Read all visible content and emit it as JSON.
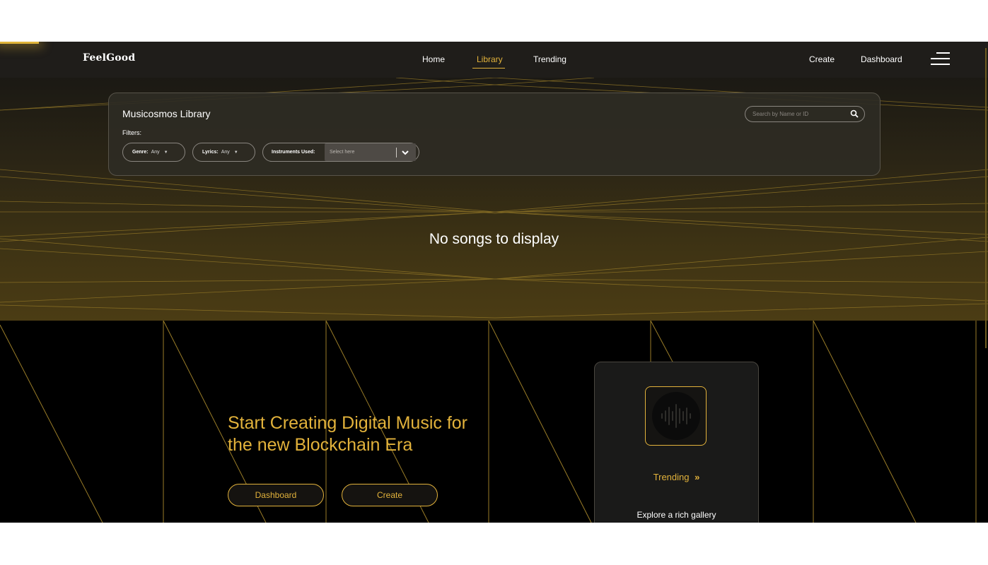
{
  "brand": {
    "logo": "FeelGood",
    "accent": "#e2b23b"
  },
  "nav": {
    "links": [
      "Home",
      "Library",
      "Trending"
    ],
    "active": "Library",
    "right_links": [
      "Create",
      "Dashboard"
    ],
    "menu_icon": "hamburger-icon"
  },
  "library": {
    "title": "Musicosmos Library",
    "filters_label": "Filters:",
    "genre": {
      "label": "Genre:",
      "value": "Any"
    },
    "lyrics": {
      "label": "Lyrics:",
      "value": "Any"
    },
    "instruments": {
      "label": "Instruments Used:",
      "placeholder": "Select here"
    },
    "search": {
      "placeholder": "Search by Name or ID",
      "icon": "search-icon"
    },
    "empty_message": "No songs to display"
  },
  "hero": {
    "title_line1": "Start Creating Digital Music for",
    "title_line2": "the new Blockchain Era",
    "buttons": [
      "Dashboard",
      "Create"
    ]
  },
  "trending_card": {
    "icon": "sound-wave-icon",
    "link": "Trending",
    "link_icon": "double-chevron-right-icon",
    "description": "Explore a rich gallery"
  }
}
